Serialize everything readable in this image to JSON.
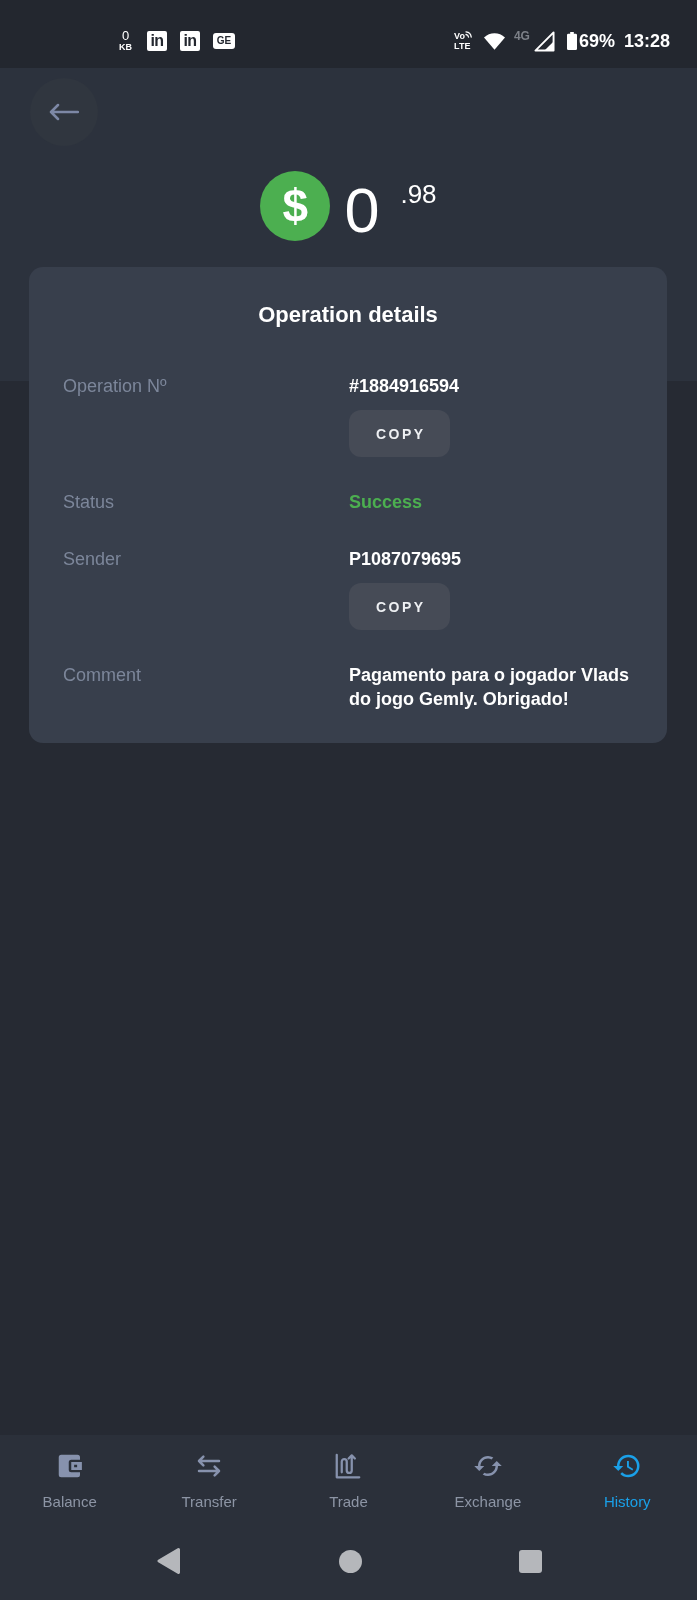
{
  "status_bar": {
    "data_speed": {
      "value": "0",
      "unit": "KB"
    },
    "notifications": [
      {
        "kind": "square",
        "label": "in"
      },
      {
        "kind": "square",
        "label": "in"
      },
      {
        "kind": "wide",
        "label": "GE"
      }
    ],
    "volte": [
      "Vo",
      "LTE"
    ],
    "network_type": "4G",
    "battery": "69%",
    "time": "13:28"
  },
  "header": {
    "currency_symbol": "$",
    "amount": {
      "integer": "0",
      "fraction": ".98"
    }
  },
  "card": {
    "title": "Operation details",
    "rows": [
      {
        "kind": "copyable",
        "label": "Operation Nº",
        "value": "#1884916594",
        "action": "COPY"
      },
      {
        "kind": "status",
        "label": "Status",
        "value": "Success"
      },
      {
        "kind": "copyable",
        "label": "Sender",
        "value": "P1087079695",
        "action": "COPY"
      },
      {
        "kind": "text",
        "label": "Comment",
        "value": "Pagamento para o jogador Vlads do jogo Gemly. Obrigado!"
      }
    ]
  },
  "bottom_nav": {
    "items": [
      {
        "label": "Balance",
        "selected": false
      },
      {
        "label": "Transfer",
        "selected": false
      },
      {
        "label": "Trade",
        "selected": false
      },
      {
        "label": "Exchange",
        "selected": false
      },
      {
        "label": "History",
        "selected": true
      }
    ]
  }
}
